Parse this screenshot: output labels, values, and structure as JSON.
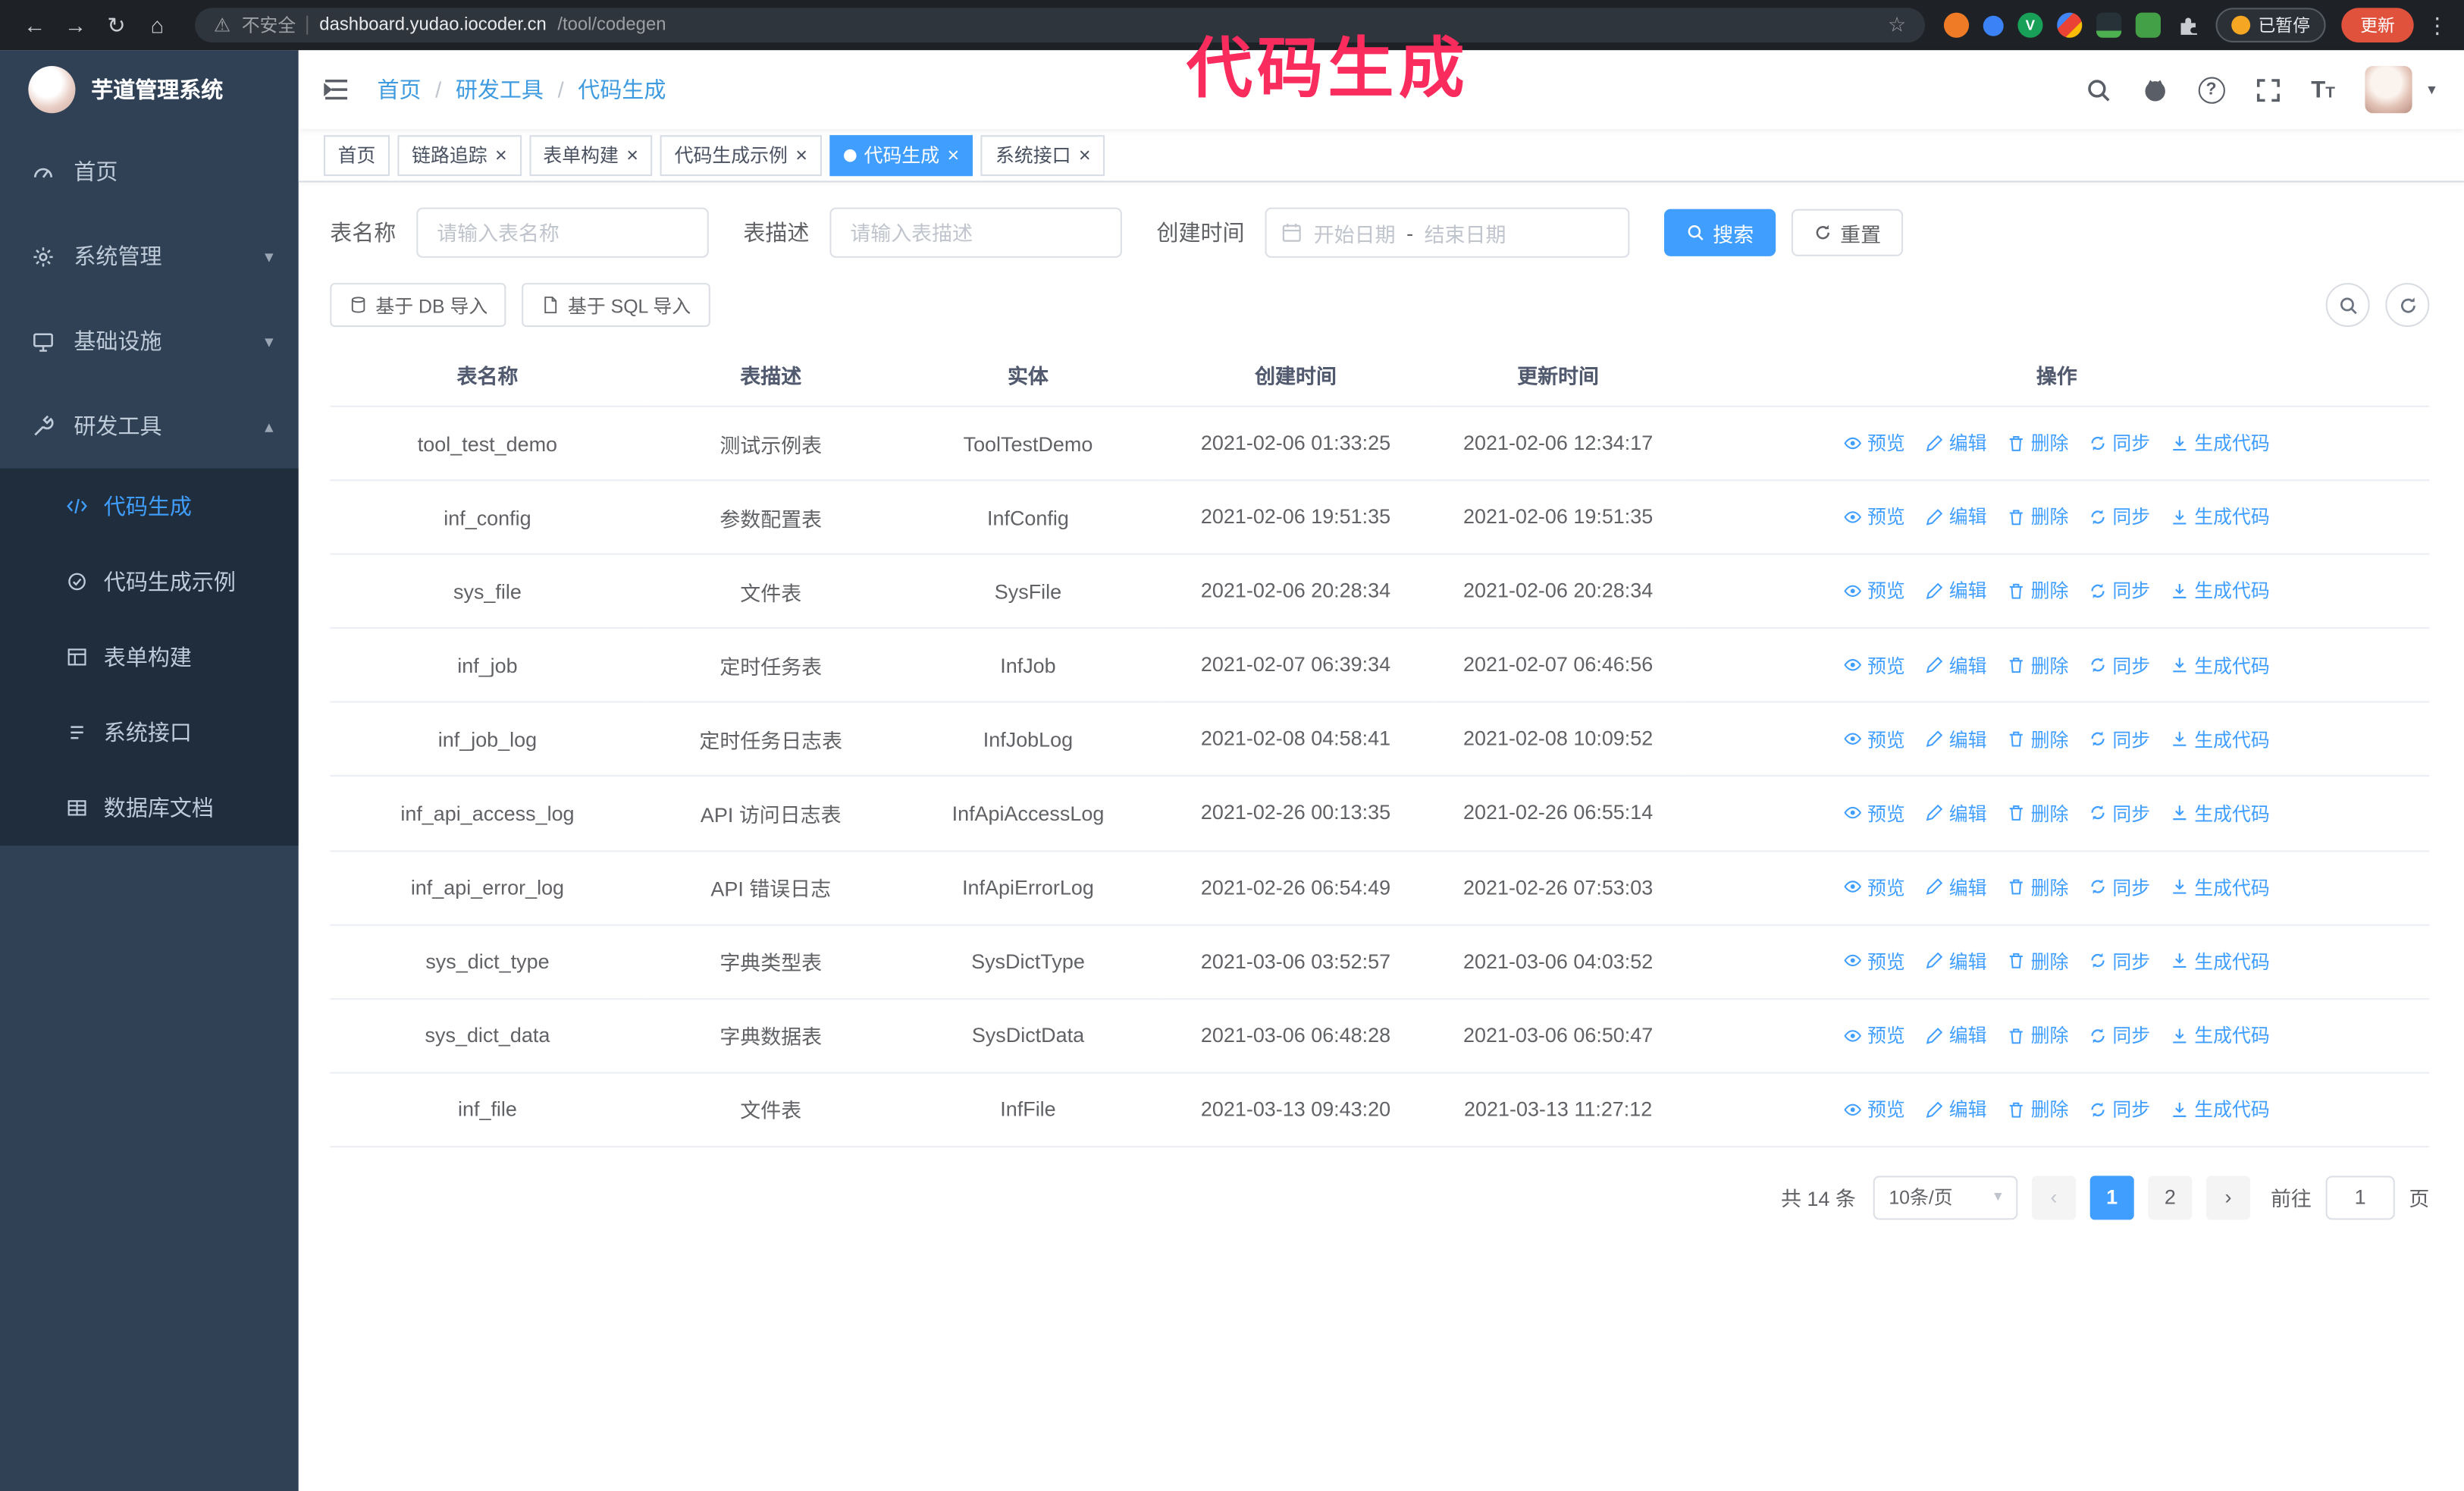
{
  "browser": {
    "security_label": "不安全",
    "url_host": "dashboard.yudao.iocoder.cn",
    "url_path": "/tool/codegen",
    "paused_badge": "已暂停",
    "update_button": "更新"
  },
  "annotation": {
    "text": "代码生成",
    "color": "#fa2c5e"
  },
  "colors": {
    "primary": "#409eff",
    "sidebar_bg": "#304156",
    "submenu_bg": "#1f2d3d",
    "chrome_bg": "#1e2227",
    "tag_active_bg": "#409eff"
  },
  "sidebar": {
    "logo_title": "芋道管理系统",
    "items": [
      {
        "label": "首页"
      },
      {
        "label": "系统管理"
      },
      {
        "label": "基础设施"
      },
      {
        "label": "研发工具"
      }
    ],
    "submenu": [
      {
        "label": "代码生成",
        "active": true
      },
      {
        "label": "代码生成示例"
      },
      {
        "label": "表单构建"
      },
      {
        "label": "系统接口"
      },
      {
        "label": "数据库文档"
      }
    ]
  },
  "header": {
    "breadcrumb": [
      "首页",
      "研发工具",
      "代码生成"
    ]
  },
  "tabs": [
    {
      "label": "首页",
      "closable": false,
      "active": false
    },
    {
      "label": "链路追踪",
      "closable": true,
      "active": false
    },
    {
      "label": "表单构建",
      "closable": true,
      "active": false
    },
    {
      "label": "代码生成示例",
      "closable": true,
      "active": false
    },
    {
      "label": "代码生成",
      "closable": true,
      "active": true
    },
    {
      "label": "系统接口",
      "closable": true,
      "active": false
    }
  ],
  "filters": {
    "name_label": "表名称",
    "name_placeholder": "请输入表名称",
    "desc_label": "表描述",
    "desc_placeholder": "请输入表描述",
    "time_label": "创建时间",
    "start_placeholder": "开始日期",
    "range_separator": "-",
    "end_placeholder": "结束日期",
    "search_label": "搜索",
    "reset_label": "重置"
  },
  "toolbar": {
    "import_db_label": "基于 DB 导入",
    "import_sql_label": "基于 SQL 导入"
  },
  "table": {
    "columns": [
      "表名称",
      "表描述",
      "实体",
      "创建时间",
      "更新时间",
      "操作"
    ],
    "actions": [
      "预览",
      "编辑",
      "删除",
      "同步",
      "生成代码"
    ],
    "rows": [
      {
        "name": "tool_test_demo",
        "desc": "测试示例表",
        "entity": "ToolTestDemo",
        "created": "2021-02-06 01:33:25",
        "updated": "2021-02-06 12:34:17"
      },
      {
        "name": "inf_config",
        "desc": "参数配置表",
        "entity": "InfConfig",
        "created": "2021-02-06 19:51:35",
        "updated": "2021-02-06 19:51:35"
      },
      {
        "name": "sys_file",
        "desc": "文件表",
        "entity": "SysFile",
        "created": "2021-02-06 20:28:34",
        "updated": "2021-02-06 20:28:34"
      },
      {
        "name": "inf_job",
        "desc": "定时任务表",
        "entity": "InfJob",
        "created": "2021-02-07 06:39:34",
        "updated": "2021-02-07 06:46:56"
      },
      {
        "name": "inf_job_log",
        "desc": "定时任务日志表",
        "entity": "InfJobLog",
        "created": "2021-02-08 04:58:41",
        "updated": "2021-02-08 10:09:52"
      },
      {
        "name": "inf_api_access_log",
        "desc": "API 访问日志表",
        "entity": "InfApiAccessLog",
        "created": "2021-02-26 00:13:35",
        "updated": "2021-02-26 06:55:14"
      },
      {
        "name": "inf_api_error_log",
        "desc": "API 错误日志",
        "entity": "InfApiErrorLog",
        "created": "2021-02-26 06:54:49",
        "updated": "2021-02-26 07:53:03"
      },
      {
        "name": "sys_dict_type",
        "desc": "字典类型表",
        "entity": "SysDictType",
        "created": "2021-03-06 03:52:57",
        "updated": "2021-03-06 04:03:52"
      },
      {
        "name": "sys_dict_data",
        "desc": "字典数据表",
        "entity": "SysDictData",
        "created": "2021-03-06 06:48:28",
        "updated": "2021-03-06 06:50:47"
      },
      {
        "name": "inf_file",
        "desc": "文件表",
        "entity": "InfFile",
        "created": "2021-03-13 09:43:20",
        "updated": "2021-03-13 11:27:12"
      }
    ]
  },
  "pagination": {
    "total": "共 14 条",
    "page_size": "10条/页",
    "pages": [
      "1",
      "2"
    ],
    "active_page": "1",
    "goto_label": "前往",
    "goto_value": "1",
    "goto_suffix": "页"
  }
}
